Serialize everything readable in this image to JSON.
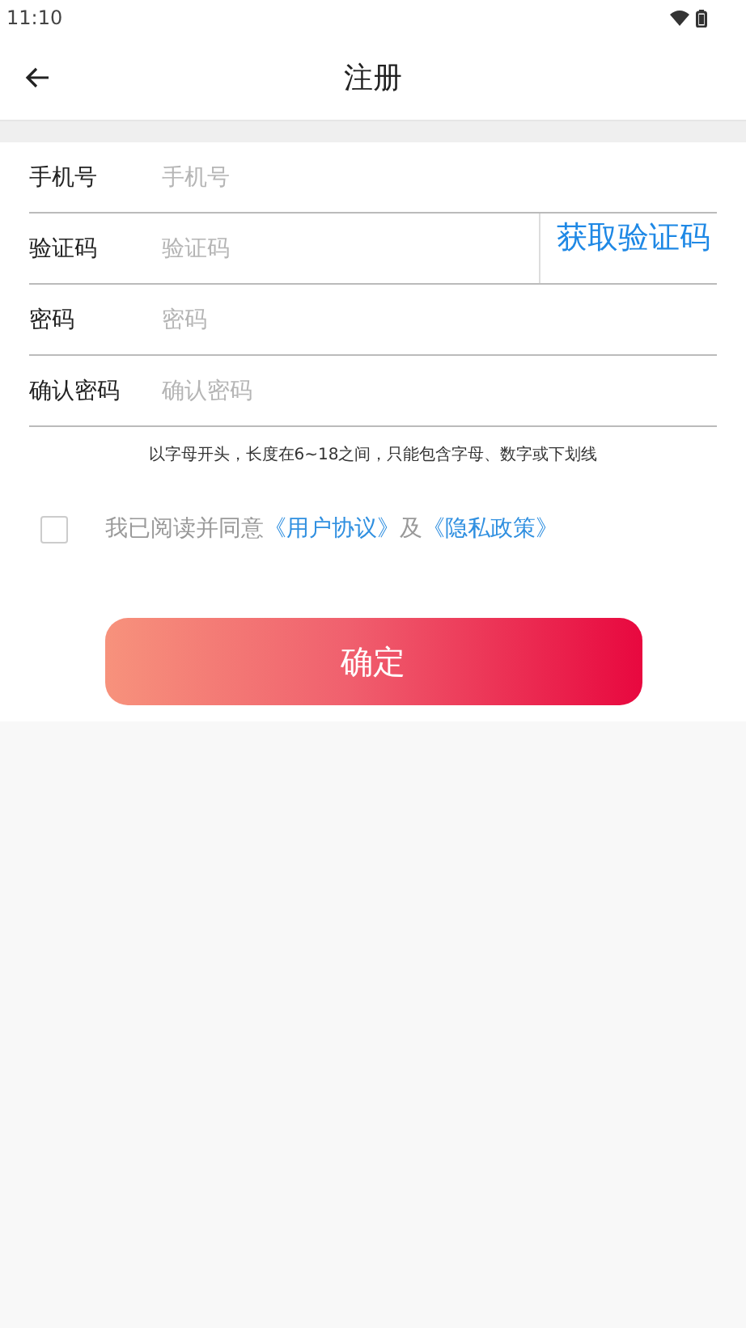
{
  "status_bar": {
    "time": "11:10"
  },
  "header": {
    "title": "注册"
  },
  "fields": [
    {
      "kind": "text",
      "label": "手机号",
      "placeholder": "手机号"
    },
    {
      "kind": "code",
      "label": "验证码",
      "placeholder": "验证码",
      "action": "获取验证码"
    },
    {
      "kind": "password",
      "label": "密码",
      "placeholder": "密码"
    },
    {
      "kind": "password",
      "label": "确认密码",
      "placeholder": "确认密码"
    }
  ],
  "hint": "以字母开头，长度在6~18之间，只能包含字母、数字或下划线",
  "agreement": {
    "checked": false,
    "prefix": "我已阅读并同意",
    "links": [
      "《用户协议》",
      "《隐私政策》"
    ],
    "joiner": "及"
  },
  "submit": "确定"
}
